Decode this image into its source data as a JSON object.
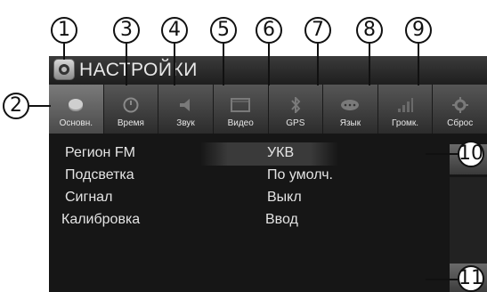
{
  "callouts": [
    "1",
    "2",
    "3",
    "4",
    "5",
    "6",
    "7",
    "8",
    "9",
    "10",
    "11"
  ],
  "screen": {
    "title": "НАСТРОЙКИ",
    "tabs": [
      {
        "label": "Основн.",
        "icon": "disc-icon",
        "active": true
      },
      {
        "label": "Время",
        "icon": "clock-icon",
        "active": false
      },
      {
        "label": "Звук",
        "icon": "speaker-icon",
        "active": false
      },
      {
        "label": "Видео",
        "icon": "film-icon",
        "active": false
      },
      {
        "label": "GPS",
        "icon": "satellite-icon",
        "active": false
      },
      {
        "label": "Язык",
        "icon": "speech-bubble-icon",
        "active": false
      },
      {
        "label": "Громк.",
        "icon": "volume-bars-icon",
        "active": false
      },
      {
        "label": "Сброс",
        "icon": "reset-gear-icon",
        "active": false
      }
    ],
    "settings": [
      {
        "label": "Регион FM",
        "value": "УКВ"
      },
      {
        "label": "Подсветка",
        "value": "По умолч."
      },
      {
        "label": "Сигнал",
        "value": "Выкл"
      },
      {
        "label": "Калибровка",
        "value": "Ввод"
      }
    ]
  }
}
